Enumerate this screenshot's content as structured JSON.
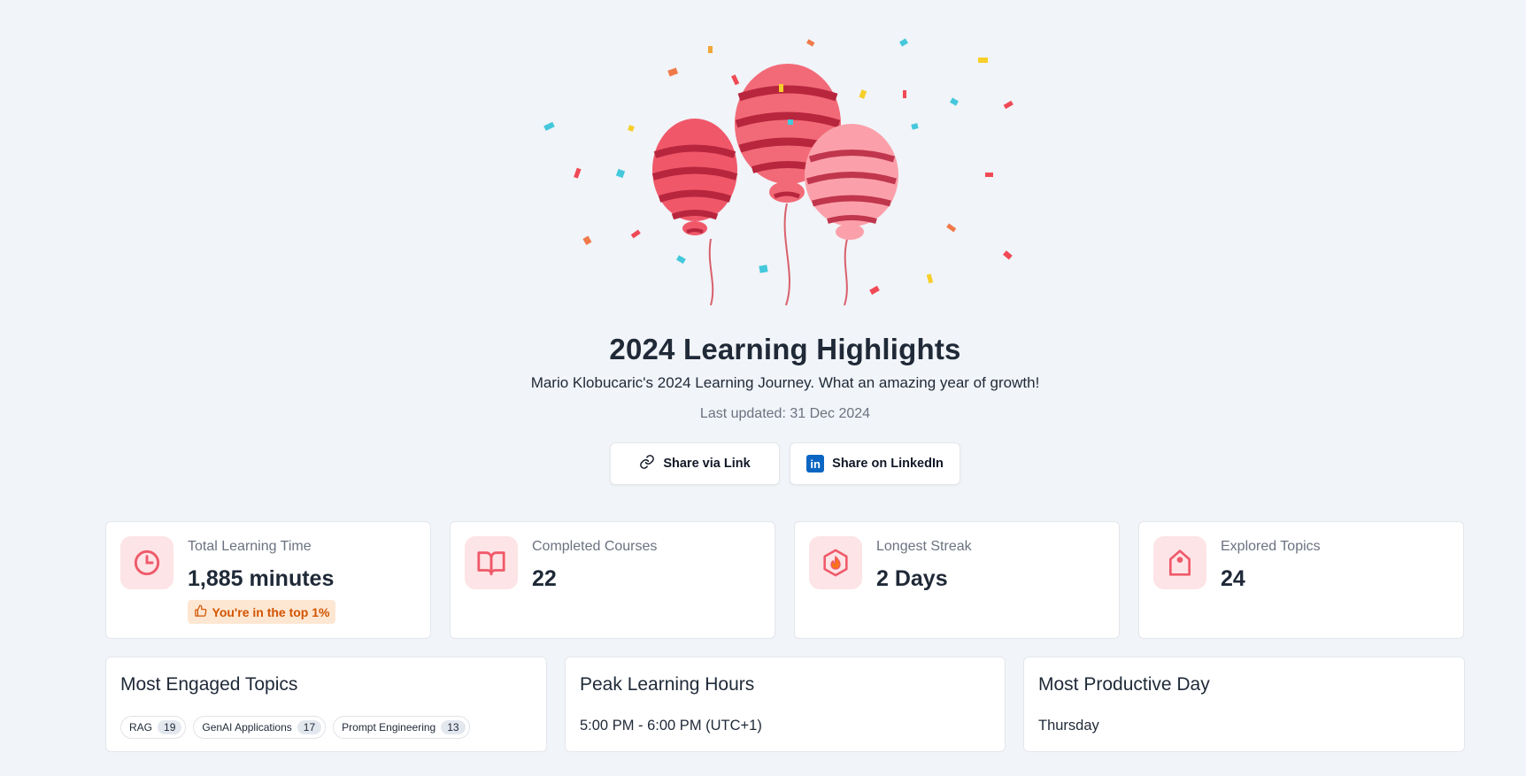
{
  "header": {
    "title": "2024 Learning Highlights",
    "subtitle": "Mario Klobucaric's 2024 Learning Journey. What an amazing year of growth!",
    "last_updated": "Last updated: 31 Dec 2024"
  },
  "actions": {
    "share_link": "Share via Link",
    "share_linkedin": "Share on LinkedIn",
    "linkedin_logo_text": "in"
  },
  "stats": [
    {
      "label": "Total Learning Time",
      "value": "1,885 minutes",
      "badge": "You're in the top 1%",
      "icon": "clock-icon"
    },
    {
      "label": "Completed Courses",
      "value": "22",
      "icon": "book-icon"
    },
    {
      "label": "Longest Streak",
      "value": "2 Days",
      "icon": "flame-hexagon-icon"
    },
    {
      "label": "Explored Topics",
      "value": "24",
      "icon": "tag-icon"
    }
  ],
  "panels": {
    "engaged": {
      "title": "Most Engaged Topics",
      "topics": [
        {
          "name": "RAG",
          "count": "19"
        },
        {
          "name": "GenAI Applications",
          "count": "17"
        },
        {
          "name": "Prompt Engineering",
          "count": "13"
        }
      ]
    },
    "peak": {
      "title": "Peak Learning Hours",
      "value": "5:00 PM - 6:00 PM (UTC+1)"
    },
    "day": {
      "title": "Most Productive Day",
      "value": "Thursday"
    }
  },
  "colors": {
    "accent": "#ef5a6a",
    "icon_bg": "#fde4e6",
    "badge_bg": "#fde7d3",
    "badge_text": "#d35400",
    "linkedin": "#0a66c2",
    "background": "#f1f4f8"
  }
}
